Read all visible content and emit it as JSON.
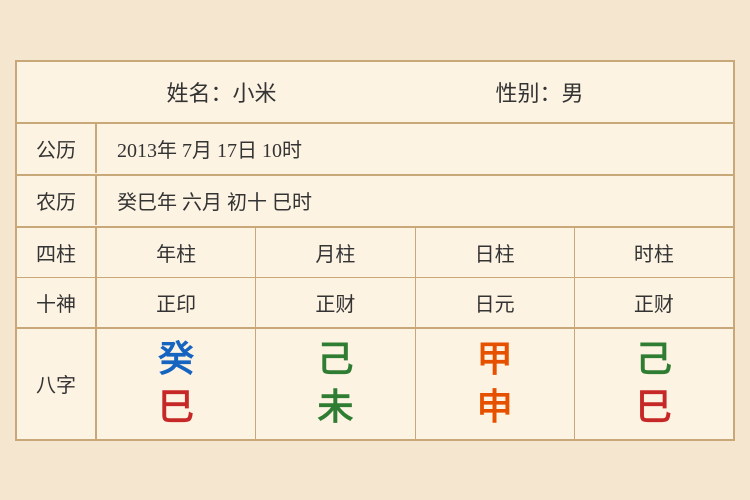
{
  "header": {
    "name_label": "姓名：小米",
    "gender_label": "性别：男"
  },
  "solar": {
    "label": "公历",
    "content": "2013年 7月 17日 10时"
  },
  "lunar": {
    "label": "农历",
    "content": "癸巳年 六月 初十 巳时"
  },
  "sizu": {
    "label": "四柱",
    "year": "年柱",
    "month": "月柱",
    "day": "日柱",
    "hour": "时柱"
  },
  "shishen": {
    "label": "十神",
    "year": "正印",
    "month": "正财",
    "day": "日元",
    "hour": "正财"
  },
  "bazi": {
    "label": "八字",
    "year_top": "癸",
    "year_bottom": "巳",
    "month_top": "己",
    "month_bottom": "未",
    "day_top": "甲",
    "day_bottom": "申",
    "hour_top": "己",
    "hour_bottom": "巳"
  }
}
